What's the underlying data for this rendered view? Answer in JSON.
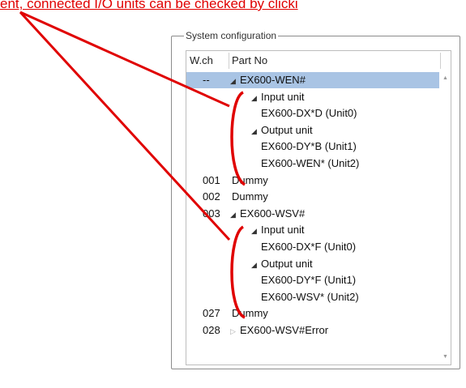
{
  "caption": "ent, connected I/O units can be checked by clicki",
  "panel": {
    "title": "System configuration"
  },
  "columns": {
    "wch": "W.ch",
    "part": "Part No"
  },
  "rows": [
    {
      "wch": "--",
      "part": "EX600-WEN#",
      "depth": 0,
      "arrow": "expanded",
      "selected": true
    },
    {
      "wch": "",
      "part": "Input unit",
      "depth": 1,
      "arrow": "expanded"
    },
    {
      "wch": "",
      "part": "EX600-DX*D (Unit0)",
      "depth": 2,
      "arrow": "none"
    },
    {
      "wch": "",
      "part": "Output unit",
      "depth": 1,
      "arrow": "expanded"
    },
    {
      "wch": "",
      "part": "EX600-DY*B (Unit1)",
      "depth": 2,
      "arrow": "none"
    },
    {
      "wch": "",
      "part": "EX600-WEN* (Unit2)",
      "depth": 2,
      "arrow": "none"
    },
    {
      "wch": "001",
      "part": "Dummy",
      "depth": 0,
      "arrow": "none"
    },
    {
      "wch": "002",
      "part": "Dummy",
      "depth": 0,
      "arrow": "none"
    },
    {
      "wch": "003",
      "part": "EX600-WSV#",
      "depth": 0,
      "arrow": "expanded"
    },
    {
      "wch": "",
      "part": "Input unit",
      "depth": 1,
      "arrow": "expanded"
    },
    {
      "wch": "",
      "part": "EX600-DX*F (Unit0)",
      "depth": 2,
      "arrow": "none"
    },
    {
      "wch": "",
      "part": "Output unit",
      "depth": 1,
      "arrow": "expanded"
    },
    {
      "wch": "",
      "part": "EX600-DY*F (Unit1)",
      "depth": 2,
      "arrow": "none"
    },
    {
      "wch": "",
      "part": "EX600-WSV* (Unit2)",
      "depth": 2,
      "arrow": "none"
    },
    {
      "wch": "027",
      "part": "Dummy",
      "depth": 0,
      "arrow": "none"
    },
    {
      "wch": "028",
      "part": "EX600-WSV#Error",
      "depth": 0,
      "arrow": "collapsed"
    }
  ],
  "icons": {
    "expanded": "triangle-expanded-icon",
    "collapsed": "triangle-collapsed-icon"
  },
  "colors": {
    "annotation": "#e00000",
    "selection": "#a9c4e4"
  }
}
